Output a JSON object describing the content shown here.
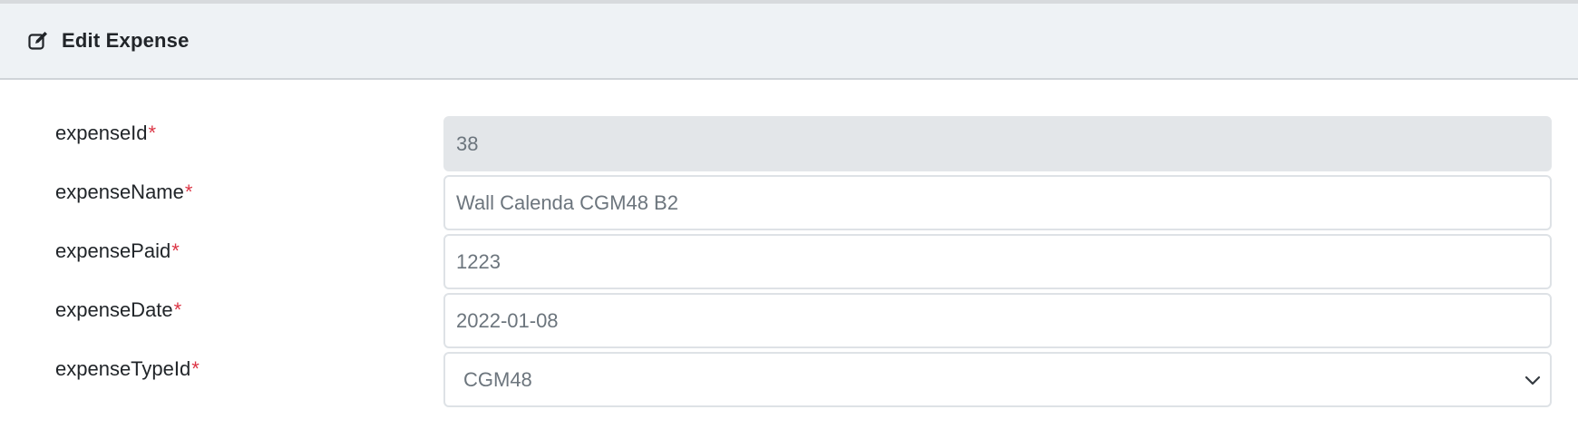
{
  "header": {
    "icon": "edit-icon",
    "title": "Edit Expense"
  },
  "form": {
    "required_mark": "*",
    "fields": [
      {
        "label": "expenseId",
        "value": "38",
        "readonly": true
      },
      {
        "label": "expenseName",
        "value": "Wall Calenda CGM48 B2"
      },
      {
        "label": "expensePaid",
        "value": "1223"
      },
      {
        "label": "expenseDate",
        "value": "2022-01-08"
      },
      {
        "label": "expenseTypeId",
        "value": "CGM48",
        "type": "select"
      }
    ]
  },
  "colors": {
    "header_bg": "#eef2f5",
    "required": "#dc3545",
    "readonly_bg": "#e3e6e9"
  }
}
